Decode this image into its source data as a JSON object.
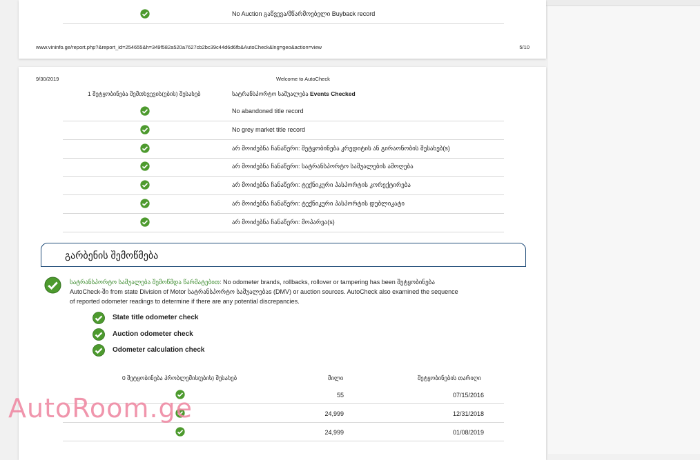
{
  "page_prev": {
    "last_row_text": "No Auction გაწვევა/მწარმოებელი Buyback record",
    "footer_url": "www.vininfo.ge/report.php?&report_id=254655&h=349f582a520a7627cb2bc39c44d6d6fb&AutoCheck&lng=geo&action=view",
    "footer_page": "5/10"
  },
  "page": {
    "date": "9/30/2019",
    "title": "Welcome to AutoCheck",
    "table_header_left": "1 შეტყობინება შემთხვევის(ების) შესახებ",
    "table_header_right_prefix": "სატრანსპორტო საშუალება ",
    "table_header_right_bold": "Events Checked",
    "rows": [
      "No abandoned title record",
      "No grey market title record",
      "არ მოიძებნა ჩანაწერი: შეტყობინება კრედიტის ან გირაონობის შესახებ(s)",
      "არ მოიძებნა ჩანაწერი: სატრანსპორტო საშუალების ამოღება",
      "არ მოიძებნა ჩანაწერი: ტექნიკური პასპორტის კორექტირება",
      "არ მოიძებნა ჩანაწერი: ტექნიკური პასპორტის დუბლიკატი",
      "არ მოიძებნა ჩანაწერი: მოპარვა(s)"
    ],
    "section_title": "გარბენის შემოწმება",
    "summary_green": "სატრანსპორტო საშუალება შემოწმდა წარმატებით",
    "summary_rest": ": No odometer brands, rollbacks, rollover or tampering has been შეტყობინება AutoCheck-ში from state Division of Motor სატრანსპორტო საშუალებაs (DMV) or auction sources. AutoCheck also examined the sequence of reported odometer readings to determine if there are any potential discrepancies.",
    "checks": [
      "State title odometer check",
      "Auction odometer check",
      "Odometer calculation check"
    ],
    "odo_header_left": "0 შეტყობინება პრობლემის(ების) შესახებ",
    "odo_header_mid": "მილი",
    "odo_header_right": "შეტყობინების თარიღი",
    "odo_rows": [
      {
        "miles": "55",
        "date": "07/15/2016"
      },
      {
        "miles": "24,999",
        "date": "12/31/2018"
      },
      {
        "miles": "24,999",
        "date": "01/08/2019"
      }
    ]
  },
  "watermark": "AutoRoom.ge",
  "colors": {
    "check_green": "#4d9a2e",
    "section_border": "#1f4b78",
    "link_green": "#3a8a2c"
  }
}
